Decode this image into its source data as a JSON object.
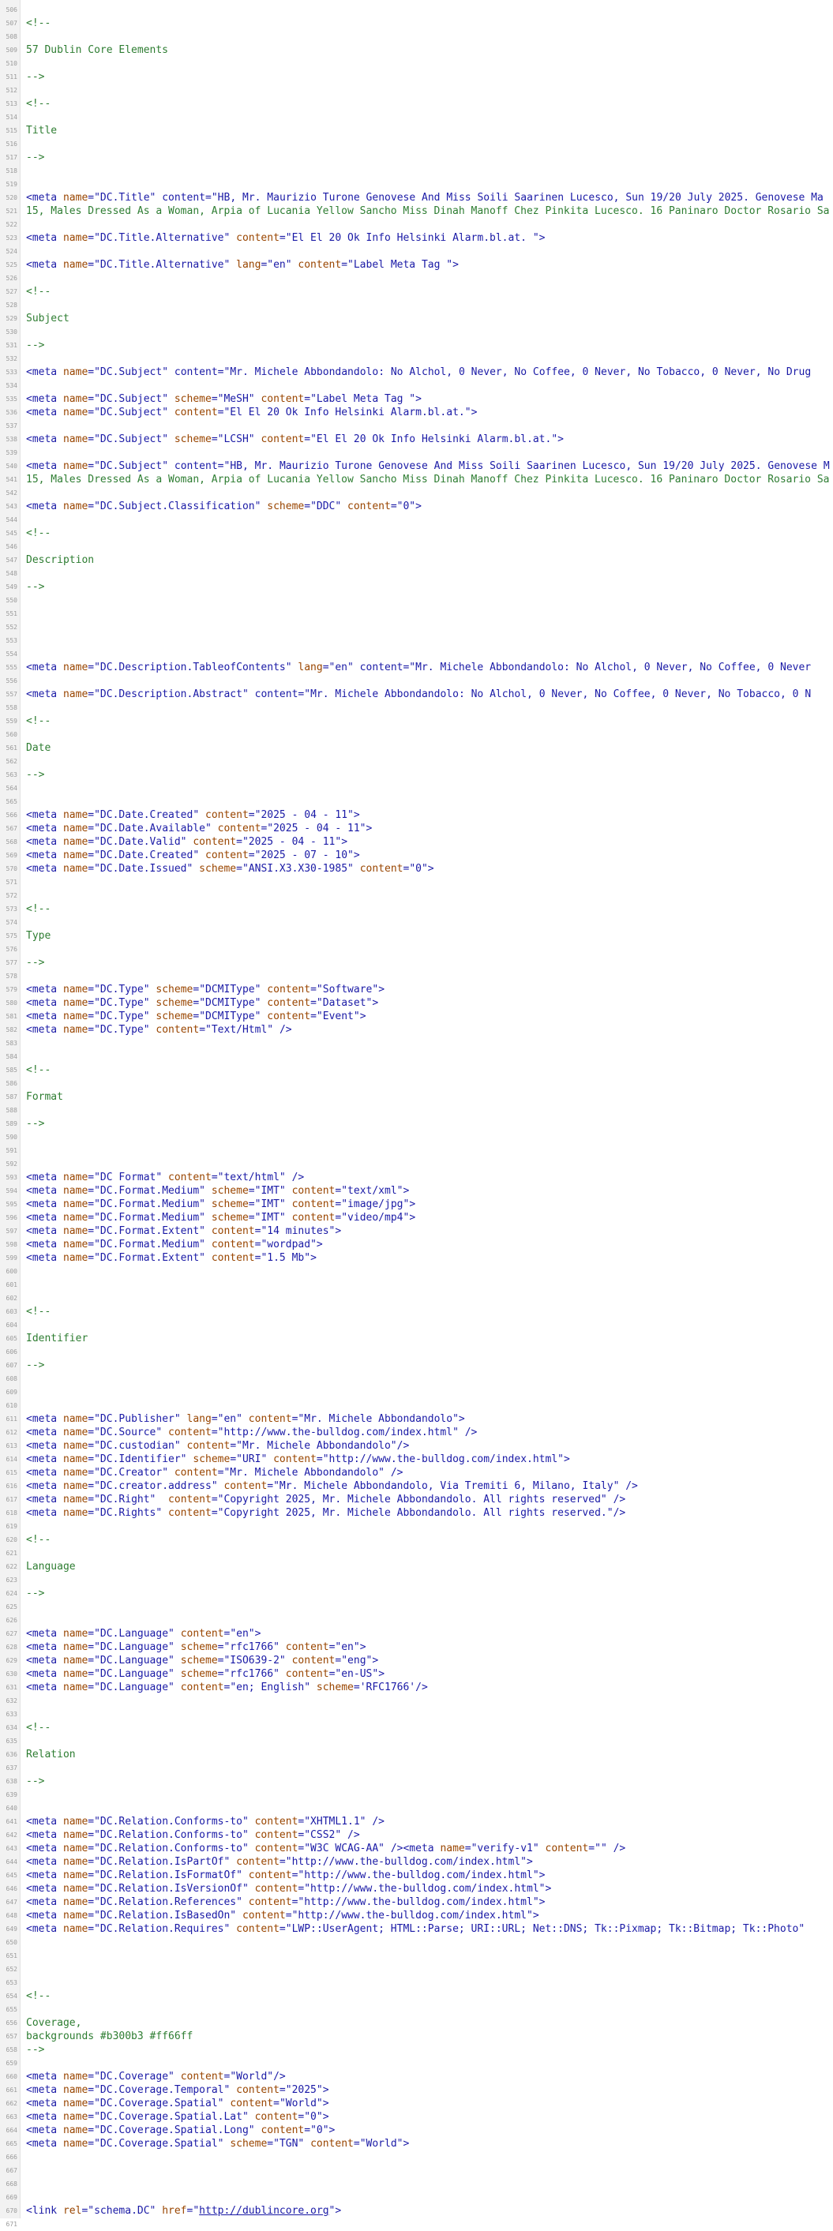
{
  "source_view": {
    "lines": [
      {
        "n": "506",
        "t": ""
      },
      {
        "n": "507",
        "t": "<!--"
      },
      {
        "n": "508",
        "t": ""
      },
      {
        "n": "509",
        "t": "57 Dublin Core Elements"
      },
      {
        "n": "510",
        "t": ""
      },
      {
        "n": "511",
        "t": "-->"
      },
      {
        "n": "512",
        "t": ""
      },
      {
        "n": "513",
        "t": "<!--"
      },
      {
        "n": "514",
        "t": ""
      },
      {
        "n": "515",
        "t": "Title"
      },
      {
        "n": "516",
        "t": ""
      },
      {
        "n": "517",
        "t": "-->"
      },
      {
        "n": "518",
        "t": ""
      },
      {
        "n": "519",
        "t": ""
      },
      {
        "n": "520",
        "t": "<meta name=\"DC.Title\" content=\"HB, Mr. Maurizio Turone Genovese And Miss Soili Saarinen Lucesco, Sun 19/20 July 2025. Genovese Ma"
      },
      {
        "n": "521",
        "t": "15, Males Dressed As a Woman, Arpia of Lucania Yellow Sancho Miss Dinah Manoff Chez Pinkita Lucesco. 16 Paninaro Doctor Rosario Sa"
      },
      {
        "n": "522",
        "t": ""
      },
      {
        "n": "523",
        "t": "<meta name=\"DC.Title.Alternative\" content=\"El El 20 Ok Info Helsinki Alarm.bl.at. \">"
      },
      {
        "n": "524",
        "t": ""
      },
      {
        "n": "525",
        "t": "<meta name=\"DC.Title.Alternative\" lang=\"en\" content=\"Label Meta Tag \">"
      },
      {
        "n": "526",
        "t": ""
      },
      {
        "n": "527",
        "t": "<!--"
      },
      {
        "n": "528",
        "t": ""
      },
      {
        "n": "529",
        "t": "Subject"
      },
      {
        "n": "530",
        "t": ""
      },
      {
        "n": "531",
        "t": "-->"
      },
      {
        "n": "532",
        "t": ""
      },
      {
        "n": "533",
        "t": "<meta name=\"DC.Subject\" content=\"Mr. Michele Abbondandolo: No Alchol, 0 Never, No Coffee, 0 Never, No Tobacco, 0 Never, No Drug"
      },
      {
        "n": "534",
        "t": ""
      },
      {
        "n": "535",
        "t": "<meta name=\"DC.Subject\" scheme=\"MeSH\" content=\"Label Meta Tag \">"
      },
      {
        "n": "536",
        "t": "<meta name=\"DC.Subject\" content=\"El El 20 Ok Info Helsinki Alarm.bl.at.\">"
      },
      {
        "n": "537",
        "t": ""
      },
      {
        "n": "538",
        "t": "<meta name=\"DC.Subject\" scheme=\"LCSH\" content=\"El El 20 Ok Info Helsinki Alarm.bl.at.\">"
      },
      {
        "n": "539",
        "t": ""
      },
      {
        "n": "540",
        "t": "<meta name=\"DC.Subject\" content=\"HB, Mr. Maurizio Turone Genovese And Miss Soili Saarinen Lucesco, Sun 19/20 July 2025. Genovese M"
      },
      {
        "n": "541",
        "t": "15, Males Dressed As a Woman, Arpia of Lucania Yellow Sancho Miss Dinah Manoff Chez Pinkita Lucesco. 16 Paninaro Doctor Rosario Sa"
      },
      {
        "n": "542",
        "t": ""
      },
      {
        "n": "543",
        "t": "<meta name=\"DC.Subject.Classification\" scheme=\"DDC\" content=\"0\">"
      },
      {
        "n": "544",
        "t": ""
      },
      {
        "n": "545",
        "t": "<!--"
      },
      {
        "n": "546",
        "t": ""
      },
      {
        "n": "547",
        "t": "Description"
      },
      {
        "n": "548",
        "t": ""
      },
      {
        "n": "549",
        "t": "-->"
      },
      {
        "n": "550",
        "t": ""
      },
      {
        "n": "551",
        "t": ""
      },
      {
        "n": "552",
        "t": ""
      },
      {
        "n": "553",
        "t": ""
      },
      {
        "n": "554",
        "t": ""
      },
      {
        "n": "555",
        "t": "<meta name=\"DC.Description.TableofContents\" lang=\"en\" content=\"Mr. Michele Abbondandolo: No Alchol, 0 Never, No Coffee, 0 Never"
      },
      {
        "n": "556",
        "t": ""
      },
      {
        "n": "557",
        "t": "<meta name=\"DC.Description.Abstract\" content=\"Mr. Michele Abbondandolo: No Alchol, 0 Never, No Coffee, 0 Never, No Tobacco, 0 N"
      },
      {
        "n": "558",
        "t": ""
      },
      {
        "n": "559",
        "t": "<!--"
      },
      {
        "n": "560",
        "t": ""
      },
      {
        "n": "561",
        "t": "Date"
      },
      {
        "n": "562",
        "t": ""
      },
      {
        "n": "563",
        "t": "-->"
      },
      {
        "n": "564",
        "t": ""
      },
      {
        "n": "565",
        "t": ""
      },
      {
        "n": "566",
        "t": "<meta name=\"DC.Date.Created\" content=\"2025 - 04 - 11\">"
      },
      {
        "n": "567",
        "t": "<meta name=\"DC.Date.Available\" content=\"2025 - 04 - 11\">"
      },
      {
        "n": "568",
        "t": "<meta name=\"DC.Date.Valid\" content=\"2025 - 04 - 11\">"
      },
      {
        "n": "569",
        "t": "<meta name=\"DC.Date.Created\" content=\"2025 - 07 - 10\">"
      },
      {
        "n": "570",
        "t": "<meta name=\"DC.Date.Issued\" scheme=\"ANSI.X3.X30-1985\" content=\"0\">"
      },
      {
        "n": "571",
        "t": ""
      },
      {
        "n": "572",
        "t": ""
      },
      {
        "n": "573",
        "t": "<!--"
      },
      {
        "n": "574",
        "t": ""
      },
      {
        "n": "575",
        "t": "Type"
      },
      {
        "n": "576",
        "t": ""
      },
      {
        "n": "577",
        "t": "-->"
      },
      {
        "n": "578",
        "t": ""
      },
      {
        "n": "579",
        "t": "<meta name=\"DC.Type\" scheme=\"DCMIType\" content=\"Software\">"
      },
      {
        "n": "580",
        "t": "<meta name=\"DC.Type\" scheme=\"DCMIType\" content=\"Dataset\">"
      },
      {
        "n": "581",
        "t": "<meta name=\"DC.Type\" scheme=\"DCMIType\" content=\"Event\">"
      },
      {
        "n": "582",
        "t": "<meta name=\"DC.Type\" content=\"Text/Html\" />"
      },
      {
        "n": "583",
        "t": ""
      },
      {
        "n": "584",
        "t": ""
      },
      {
        "n": "585",
        "t": "<!--"
      },
      {
        "n": "586",
        "t": ""
      },
      {
        "n": "587",
        "t": "Format"
      },
      {
        "n": "588",
        "t": ""
      },
      {
        "n": "589",
        "t": "-->"
      },
      {
        "n": "590",
        "t": ""
      },
      {
        "n": "591",
        "t": ""
      },
      {
        "n": "592",
        "t": ""
      },
      {
        "n": "593",
        "t": "<meta name=\"DC Format\" content=\"text/html\" />"
      },
      {
        "n": "594",
        "t": "<meta name=\"DC.Format.Medium\" scheme=\"IMT\" content=\"text/xml\">"
      },
      {
        "n": "595",
        "t": "<meta name=\"DC.Format.Medium\" scheme=\"IMT\" content=\"image/jpg\">"
      },
      {
        "n": "596",
        "t": "<meta name=\"DC.Format.Medium\" scheme=\"IMT\" content=\"video/mp4\">"
      },
      {
        "n": "597",
        "t": "<meta name=\"DC.Format.Extent\" content=\"14 minutes\">"
      },
      {
        "n": "598",
        "t": "<meta name=\"DC.Format.Medium\" content=\"wordpad\">"
      },
      {
        "n": "599",
        "t": "<meta name=\"DC.Format.Extent\" content=\"1.5 Mb\">"
      },
      {
        "n": "600",
        "t": ""
      },
      {
        "n": "601",
        "t": ""
      },
      {
        "n": "602",
        "t": ""
      },
      {
        "n": "603",
        "t": "<!--"
      },
      {
        "n": "604",
        "t": ""
      },
      {
        "n": "605",
        "t": "Identifier"
      },
      {
        "n": "606",
        "t": ""
      },
      {
        "n": "607",
        "t": "-->"
      },
      {
        "n": "608",
        "t": ""
      },
      {
        "n": "609",
        "t": ""
      },
      {
        "n": "610",
        "t": ""
      },
      {
        "n": "611",
        "t": "<meta name=\"DC.Publisher\" lang=\"en\" content=\"Mr. Michele Abbondandolo\">"
      },
      {
        "n": "612",
        "t": "<meta name=\"DC.Source\" content=\"http://www.the-bulldog.com/index.html\" />"
      },
      {
        "n": "613",
        "t": "<meta name=\"DC.custodian\" content=\"Mr. Michele Abbondandolo\"/>"
      },
      {
        "n": "614",
        "t": "<meta name=\"DC.Identifier\" scheme=\"URI\" content=\"http://www.the-bulldog.com/index.html\">"
      },
      {
        "n": "615",
        "t": "<meta name=\"DC.Creator\" content=\"Mr. Michele Abbondandolo\" />"
      },
      {
        "n": "616",
        "t": "<meta name=\"DC.creator.address\" content=\"Mr. Michele Abbondandolo, Via Tremiti 6, Milano, Italy\" />"
      },
      {
        "n": "617",
        "t": "<meta name=\"DC.Right\"  content=\"Copyright 2025, Mr. Michele Abbondandolo. All rights reserved\" />"
      },
      {
        "n": "618",
        "t": "<meta name=\"DC.Rights\" content=\"Copyright 2025, Mr. Michele Abbondandolo. All rights reserved.\"/>"
      },
      {
        "n": "619",
        "t": ""
      },
      {
        "n": "620",
        "t": "<!--"
      },
      {
        "n": "621",
        "t": ""
      },
      {
        "n": "622",
        "t": "Language"
      },
      {
        "n": "623",
        "t": ""
      },
      {
        "n": "624",
        "t": "-->"
      },
      {
        "n": "625",
        "t": ""
      },
      {
        "n": "626",
        "t": ""
      },
      {
        "n": "627",
        "t": "<meta name=\"DC.Language\" content=\"en\">"
      },
      {
        "n": "628",
        "t": "<meta name=\"DC.Language\" scheme=\"rfc1766\" content=\"en\">"
      },
      {
        "n": "629",
        "t": "<meta name=\"DC.Language\" scheme=\"ISO639-2\" content=\"eng\">"
      },
      {
        "n": "630",
        "t": "<meta name=\"DC.Language\" scheme=\"rfc1766\" content=\"en-US\">"
      },
      {
        "n": "631",
        "t": "<meta name=\"DC.Language\" content=\"en; English\" scheme='RFC1766'/>"
      },
      {
        "n": "632",
        "t": ""
      },
      {
        "n": "633",
        "t": ""
      },
      {
        "n": "634",
        "t": "<!--"
      },
      {
        "n": "635",
        "t": ""
      },
      {
        "n": "636",
        "t": "Relation"
      },
      {
        "n": "637",
        "t": ""
      },
      {
        "n": "638",
        "t": "-->"
      },
      {
        "n": "639",
        "t": ""
      },
      {
        "n": "640",
        "t": ""
      },
      {
        "n": "641",
        "t": "<meta name=\"DC.Relation.Conforms-to\" content=\"XHTML1.1\" />"
      },
      {
        "n": "642",
        "t": "<meta name=\"DC.Relation.Conforms-to\" content=\"CSS2\" />"
      },
      {
        "n": "643",
        "t": "<meta name=\"DC.Relation.Conforms-to\" content=\"W3C WCAG-AA\" /><meta name=\"verify-v1\" content=\"\" />"
      },
      {
        "n": "644",
        "t": "<meta name=\"DC.Relation.IsPartOf\" content=\"http://www.the-bulldog.com/index.html\">"
      },
      {
        "n": "645",
        "t": "<meta name=\"DC.Relation.IsFormatOf\" content=\"http://www.the-bulldog.com/index.html\">"
      },
      {
        "n": "646",
        "t": "<meta name=\"DC.Relation.IsVersionOf\" content=\"http://www.the-bulldog.com/index.html\">"
      },
      {
        "n": "647",
        "t": "<meta name=\"DC.Relation.References\" content=\"http://www.the-bulldog.com/index.html\">"
      },
      {
        "n": "648",
        "t": "<meta name=\"DC.Relation.IsBasedOn\" content=\"http://www.the-bulldog.com/index.html\">"
      },
      {
        "n": "649",
        "t": "<meta name=\"DC.Relation.Requires\" content=\"LWP::UserAgent; HTML::Parse; URI::URL; Net::DNS; Tk::Pixmap; Tk::Bitmap; Tk::Photo\""
      },
      {
        "n": "650",
        "t": ""
      },
      {
        "n": "651",
        "t": ""
      },
      {
        "n": "652",
        "t": ""
      },
      {
        "n": "653",
        "t": ""
      },
      {
        "n": "654",
        "t": "<!--"
      },
      {
        "n": "655",
        "t": ""
      },
      {
        "n": "656",
        "t": "Coverage,"
      },
      {
        "n": "657",
        "t": "backgrounds #b300b3 #ff66ff"
      },
      {
        "n": "658",
        "t": "-->"
      },
      {
        "n": "659",
        "t": ""
      },
      {
        "n": "660",
        "t": "<meta name=\"DC.Coverage\" content=\"World\"/>"
      },
      {
        "n": "661",
        "t": "<meta name=\"DC.Coverage.Temporal\" content=\"2025\">"
      },
      {
        "n": "662",
        "t": "<meta name=\"DC.Coverage.Spatial\" content=\"World\">"
      },
      {
        "n": "663",
        "t": "<meta name=\"DC.Coverage.Spatial.Lat\" content=\"0\">"
      },
      {
        "n": "664",
        "t": "<meta name=\"DC.Coverage.Spatial.Long\" content=\"0\">"
      },
      {
        "n": "665",
        "t": "<meta name=\"DC.Coverage.Spatial\" scheme=\"TGN\" content=\"World\">"
      },
      {
        "n": "666",
        "t": ""
      },
      {
        "n": "667",
        "t": ""
      },
      {
        "n": "668",
        "t": ""
      },
      {
        "n": "669",
        "t": ""
      },
      {
        "n": "670",
        "t": "<link rel=\"schema.DC\" href=\"http://dublincore.org\">"
      },
      {
        "n": "671",
        "t": ""
      }
    ]
  },
  "colors": {
    "comment": "#2e7d32",
    "tag": "#1a1aa6",
    "attribute": "#994500",
    "value": "#1a1aa6",
    "gutter_bg": "#f2f2f2",
    "line_number": "#9a9a9a"
  }
}
